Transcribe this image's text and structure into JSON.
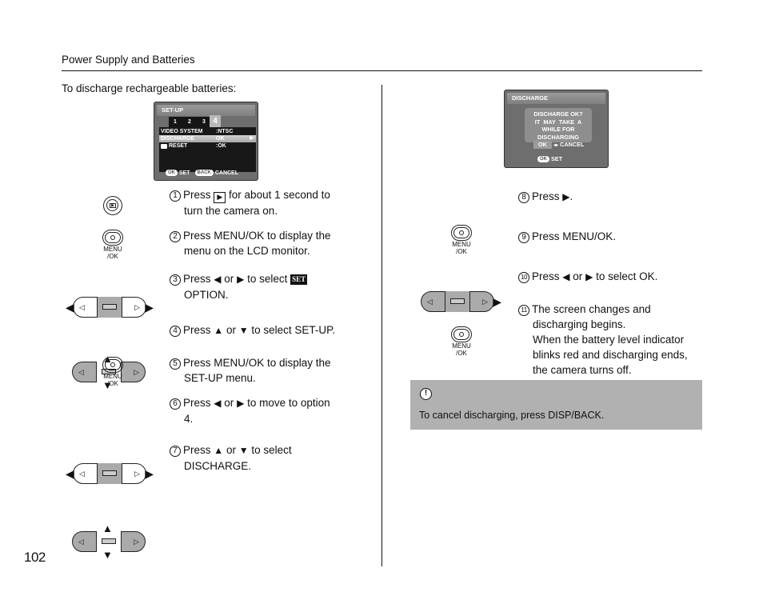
{
  "header": {
    "title": "Power Supply and Batteries"
  },
  "intro": "To discharge rechargeable batteries:",
  "page_number": "102",
  "lcd_setup": {
    "title": "SET-UP",
    "tabs": [
      "1",
      "2",
      "3"
    ],
    "active_tab": "4",
    "rows": [
      {
        "label": "VIDEO SYSTEM",
        "value": ":NTSC",
        "selected": false
      },
      {
        "label": "DISCHARGE",
        "value": "OK",
        "selected": true
      },
      {
        "label": "RESET",
        "value": ":OK",
        "selected": false
      }
    ],
    "footer": {
      "ok_key": "OK",
      "set": "SET",
      "back_key": "BACK",
      "cancel": "CANCEL"
    },
    "icon": "camera-icon"
  },
  "lcd_discharge": {
    "title": "DISCHARGE",
    "dialog_lines": [
      "DISCHARGE OK?",
      "IT  MAY  TAKE  A",
      "WHILE FOR",
      "DISCHARGING"
    ],
    "ok": "OK",
    "lr_arrows": "◂▸",
    "cancel": "CANCEL",
    "ok_key": "OK",
    "set": "SET"
  },
  "left_steps": [
    {
      "num": "1",
      "parts": [
        "Press",
        "for about 1 second to",
        "turn the camera on."
      ],
      "icon": "playback-button",
      "inline_icon": "playback-icon"
    },
    {
      "num": "2",
      "line1": "Press MENU/OK to display the",
      "line2": "menu on the LCD monitor.",
      "icon": "menu-ok-button"
    },
    {
      "num": "3",
      "press": "Press",
      "or": "or",
      "to": "to select",
      "set_label": "SET",
      "line2": "OPTION.",
      "icon": "left-right-pad"
    },
    {
      "num": "4",
      "press": "Press",
      "or": "or",
      "to": "to select SET-UP.",
      "icon": "up-down-pad"
    },
    {
      "num": "5",
      "line1": "Press MENU/OK to display the",
      "line2": "SET-UP menu.",
      "icon": "menu-ok-button"
    },
    {
      "num": "6",
      "press": "Press",
      "or": "or",
      "to": "to move to option",
      "line2": "4.",
      "icon": "left-right-pad"
    },
    {
      "num": "7",
      "press": "Press",
      "or": "or",
      "to": "to select",
      "line2": "DISCHARGE.",
      "icon": "up-down-pad"
    }
  ],
  "right_steps": [
    {
      "num": "8",
      "press": "Press",
      "after": ".",
      "icon": "right-pad"
    },
    {
      "num": "9",
      "line1": "Press MENU/OK.",
      "icon": "menu-ok-button"
    },
    {
      "num": "10",
      "press": "Press",
      "or": "or",
      "to": "to select OK.",
      "icon": "left-right-pad"
    },
    {
      "num": "11",
      "lines": [
        "The screen changes and",
        "discharging begins.",
        "When the battery level indicator",
        "blinks red and discharging ends,",
        "the camera turns off."
      ],
      "icon": "menu-ok-button"
    }
  ],
  "button_labels": {
    "menu": "MENU",
    "ok": "/OK"
  },
  "arrows": {
    "left": "◀",
    "right": "▶",
    "up": "▲",
    "down": "▼",
    "small_left": "◁",
    "small_right": "▷"
  },
  "note": {
    "icon": "!",
    "text": "To cancel discharging, press DISP/BACK."
  },
  "colors": {
    "note_bg": "#b1b1b1",
    "lcd_bg": "#6e6e6e",
    "pad_gray": "#aaaaaa"
  }
}
